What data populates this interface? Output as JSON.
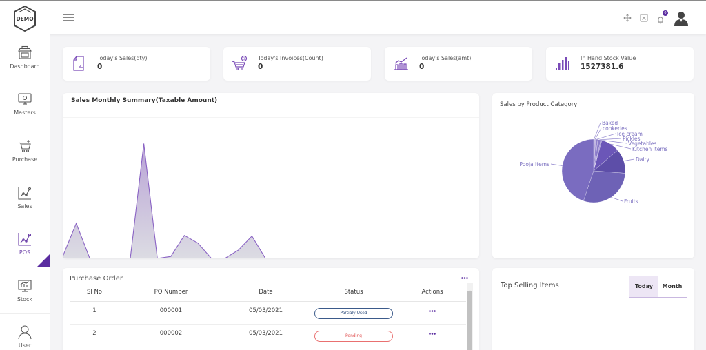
{
  "app": {
    "logo_text": "DEMO"
  },
  "topbar": {
    "icons": [
      "move-icon",
      "fullscreen-icon",
      "bell-icon",
      "user-avatar"
    ],
    "notification_count": "0"
  },
  "sidebar": {
    "items": [
      {
        "label": "Dashboard",
        "icon": "store-icon",
        "active": false
      },
      {
        "label": "Masters",
        "icon": "monitor-icon",
        "active": false
      },
      {
        "label": "Purchase",
        "icon": "cart-plus-icon",
        "active": false
      },
      {
        "label": "Sales",
        "icon": "line-chart-icon",
        "active": false
      },
      {
        "label": "POS",
        "icon": "line-chart-icon",
        "active": true
      },
      {
        "label": "Stock",
        "icon": "presentation-chart-icon",
        "active": false
      },
      {
        "label": "User",
        "icon": "user-icon",
        "active": false
      }
    ]
  },
  "stats": [
    {
      "label": "Today's Sales(qty)",
      "value": "0",
      "icon": "document-chart-icon"
    },
    {
      "label": "Today's Invoices(Count)",
      "value": "0",
      "icon": "cart-badge-icon"
    },
    {
      "label": "Today's Sales(amt)",
      "value": "0",
      "icon": "bar-chart-trend-icon"
    },
    {
      "label": "In Hand Stock Value",
      "value": "1527381.6",
      "icon": "bar-chart-icon"
    }
  ],
  "colors": {
    "accent": "#6b3fa8",
    "area_line": "#8a63c4",
    "pie_slices": [
      "#a89ad6",
      "#9a8ccf",
      "#9080cc",
      "#8a7bc9",
      "#8573c6",
      "#6b56b8",
      "#5d4ea8",
      "#6e62b6",
      "#7a6cc0"
    ]
  },
  "chart_data": [
    {
      "type": "area",
      "title": "Sales Monthly Summary(Taxable Amount)",
      "xlabel": "",
      "ylabel": "",
      "grid": false,
      "x": [
        1,
        2,
        3,
        4,
        5,
        6,
        7,
        8,
        9,
        10,
        11,
        12,
        13,
        14,
        15,
        16,
        17,
        18,
        19,
        20,
        21,
        22,
        23,
        24,
        25,
        26,
        27,
        28,
        29,
        30,
        31
      ],
      "values": [
        3,
        55,
        0,
        0,
        0,
        0,
        180,
        0,
        3,
        36,
        24,
        0,
        0,
        13,
        35,
        0,
        0,
        0,
        0,
        0,
        0,
        0,
        0,
        0,
        0,
        0,
        0,
        0,
        0,
        0,
        0
      ],
      "ylim": [
        0,
        200
      ]
    },
    {
      "type": "pie",
      "title": "Sales by Product Category",
      "labels": [
        "Baked",
        "cookeries",
        "Ice cream",
        "Pickles",
        "Vegetables",
        "Kitchen Items",
        "Dairy",
        "Fruits",
        "Pooja Items"
      ],
      "values": [
        0.5,
        0.5,
        1.2,
        1.5,
        0.5,
        9.5,
        12.5,
        29,
        44.8
      ]
    }
  ],
  "purchase_order": {
    "title": "Purchase Order",
    "columns": [
      "Sl No",
      "PO Number",
      "Date",
      "Status",
      "Actions"
    ],
    "rows": [
      {
        "sl": "1",
        "po": "000001",
        "date": "05/03/2021",
        "status": "Partialy Used",
        "status_type": "blue"
      },
      {
        "sl": "2",
        "po": "000002",
        "date": "05/03/2021",
        "status": "Pending",
        "status_type": "red"
      }
    ]
  },
  "top_selling": {
    "title": "Top Selling Items",
    "tabs": [
      {
        "label": "Today",
        "active": true
      },
      {
        "label": "Month",
        "active": false
      }
    ]
  }
}
